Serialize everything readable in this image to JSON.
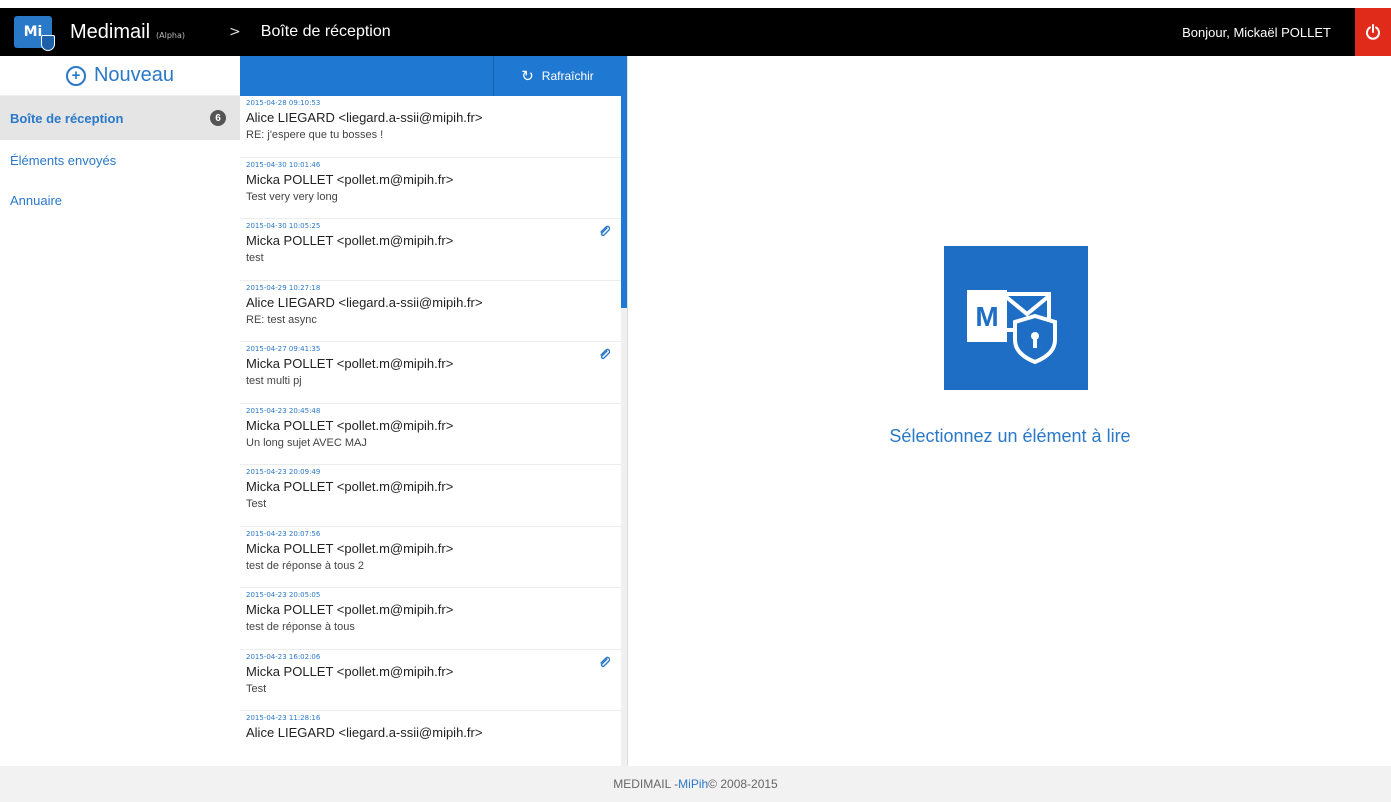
{
  "header": {
    "logo_text": "Mi",
    "app_name": "Medimail",
    "app_tag": "(Alpha)",
    "breadcrumb_separator": ">",
    "breadcrumb_current": "Boîte de réception",
    "greeting": "Bonjour, Mickaël POLLET",
    "power_icon": "power-icon"
  },
  "sidebar": {
    "new_label": "Nouveau",
    "items": [
      {
        "label": "Boîte de réception",
        "badge": "6",
        "active": true
      },
      {
        "label": "Éléments envoyés"
      },
      {
        "label": "Annuaire"
      }
    ]
  },
  "mail_toolbar": {
    "refresh_label": "Rafraîchir"
  },
  "mails": [
    {
      "date": "2015-04-28 09:10:53",
      "from": "Alice LIEGARD <liegard.a-ssii@mipih.fr>",
      "subject": "RE: j'espere que tu bosses !",
      "attachment": false
    },
    {
      "date": "2015-04-30 10:01:46",
      "from": "Micka POLLET <pollet.m@mipih.fr>",
      "subject": "Test very very long",
      "attachment": false
    },
    {
      "date": "2015-04-30 10:05:25",
      "from": "Micka POLLET <pollet.m@mipih.fr>",
      "subject": "test",
      "attachment": true
    },
    {
      "date": "2015-04-29 10:27:18",
      "from": "Alice LIEGARD <liegard.a-ssii@mipih.fr>",
      "subject": "RE: test async",
      "attachment": false
    },
    {
      "date": "2015-04-27 09:41:35",
      "from": "Micka POLLET <pollet.m@mipih.fr>",
      "subject": "test multi pj",
      "attachment": true
    },
    {
      "date": "2015-04-23 20:45:48",
      "from": "Micka POLLET <pollet.m@mipih.fr>",
      "subject": "Un long sujet AVEC MAJ",
      "attachment": false
    },
    {
      "date": "2015-04-23 20:09:49",
      "from": "Micka POLLET <pollet.m@mipih.fr>",
      "subject": "Test",
      "attachment": false
    },
    {
      "date": "2015-04-23 20:07:56",
      "from": "Micka POLLET <pollet.m@mipih.fr>",
      "subject": "test de réponse à tous 2",
      "attachment": false
    },
    {
      "date": "2015-04-23 20:05:05",
      "from": "Micka POLLET <pollet.m@mipih.fr>",
      "subject": "test de réponse à tous",
      "attachment": false
    },
    {
      "date": "2015-04-23 16:02:06",
      "from": "Micka POLLET <pollet.m@mipih.fr>",
      "subject": "Test",
      "attachment": true
    },
    {
      "date": "2015-04-23 11:28:16",
      "from": "Alice LIEGARD <liegard.a-ssii@mipih.fr>",
      "subject": "",
      "attachment": false
    }
  ],
  "reading_pane": {
    "logo_letter": "M",
    "hint": "Sélectionnez un élément à lire"
  },
  "footer": {
    "prefix": "MEDIMAIL - ",
    "brand": "MiPih",
    "suffix": " © 2008-2015"
  },
  "colors": {
    "accent": "#1f78d1",
    "topbar": "#000000",
    "power": "#e02a1a"
  }
}
